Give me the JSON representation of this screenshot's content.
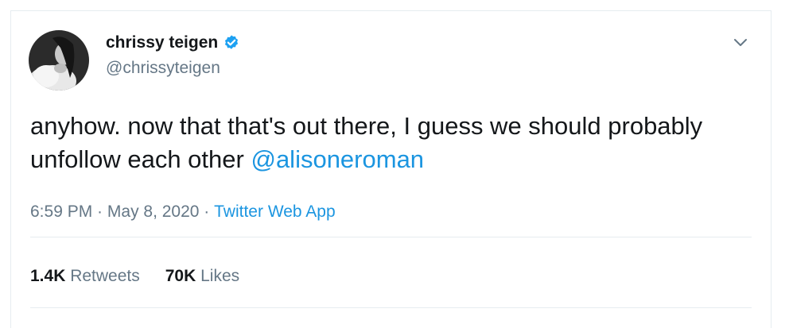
{
  "author": {
    "name": "chrissy teigen",
    "handle": "@chrissyteigen",
    "verified": true
  },
  "tweet": {
    "text": "anyhow. now that that's out there, I guess we should probably unfollow each other ",
    "mention": "@alisoneroman"
  },
  "meta": {
    "time": "6:59 PM",
    "separator1": " · ",
    "date": "May 8, 2020",
    "separator2": " · ",
    "app": "Twitter Web App"
  },
  "stats": {
    "retweets_count": "1.4K",
    "retweets_label": "Retweets",
    "likes_count": "70K",
    "likes_label": "Likes"
  },
  "colors": {
    "link": "#1b95e0",
    "muted": "#657786",
    "text": "#14171a"
  }
}
